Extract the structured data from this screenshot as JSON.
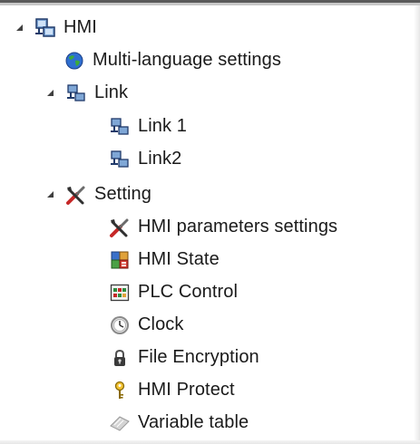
{
  "tree": {
    "root": {
      "label": "HMI",
      "icon": "hmi-network-icon",
      "expanded": true
    },
    "multilang": {
      "label": "Multi-language settings",
      "icon": "globe-icon"
    },
    "link": {
      "label": "Link",
      "icon": "link-network-icon",
      "expanded": true,
      "children": [
        {
          "label": "Link 1",
          "icon": "link-network-icon"
        },
        {
          "label": "Link2",
          "icon": "link-network-icon"
        }
      ]
    },
    "setting": {
      "label": "Setting",
      "icon": "tools-icon",
      "expanded": true,
      "children": [
        {
          "label": "HMI parameters settings",
          "icon": "tools-icon"
        },
        {
          "label": "HMI State",
          "icon": "state-icon"
        },
        {
          "label": "PLC Control",
          "icon": "plc-control-icon"
        },
        {
          "label": "Clock",
          "icon": "clock-icon"
        },
        {
          "label": "File Encryption",
          "icon": "lock-icon"
        },
        {
          "label": "HMI Protect",
          "icon": "key-icon"
        },
        {
          "label": "Variable table",
          "icon": "variable-table-icon"
        }
      ]
    }
  }
}
